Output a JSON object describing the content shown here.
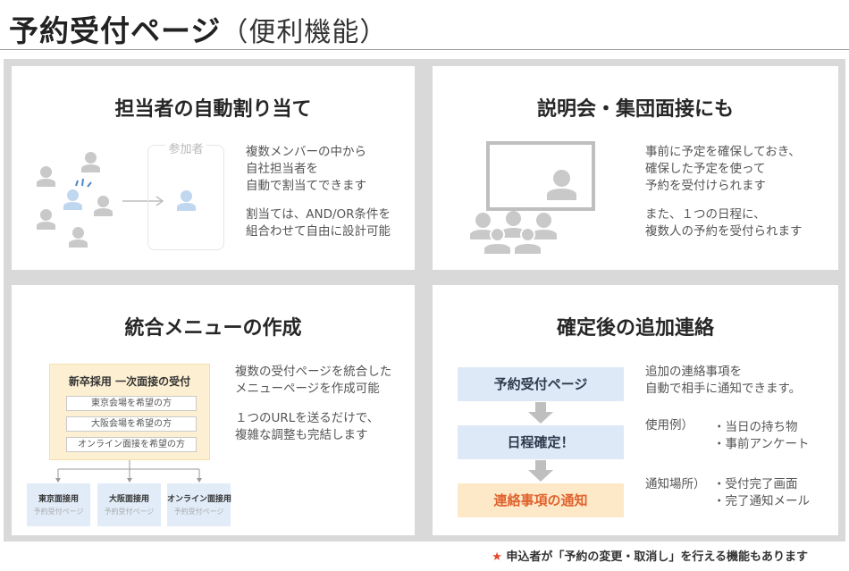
{
  "header": {
    "title": "予約受付ページ",
    "subtitle": "（便利機能）"
  },
  "panels": {
    "assign": {
      "title": "担当者の自動割り当て",
      "box_label": "参加者",
      "text1": "複数メンバーの中から\n自社担当者を\n自動で割当てできます",
      "text2": "割当ては、AND/OR条件を\n組合わせて自由に設計可能"
    },
    "group": {
      "title": "説明会・集団面接にも",
      "text1": "事前に予定を確保しておき、\n確保した予定を使って\n予約を受付けられます",
      "text2": "また、１つの日程に、\n複数人の予約を受付られます"
    },
    "menu": {
      "title": "統合メニューの作成",
      "menu_title": "新卒採用 一次面接の受付",
      "options": [
        "東京会場を希望の方",
        "大阪会場を希望の方",
        "オンライン面接を希望の方"
      ],
      "subpages": [
        {
          "title": "東京面接用",
          "sub": "予約受付ページ"
        },
        {
          "title": "大阪面接用",
          "sub": "予約受付ページ"
        },
        {
          "title": "オンライン面接用",
          "sub": "予約受付ページ"
        }
      ],
      "text1": "複数の受付ページを統合した\nメニューページを作成可能",
      "text2": "１つのURLを送るだけで、\n複雑な調整も完結します"
    },
    "followup": {
      "title": "確定後の追加連絡",
      "flow": [
        "予約受付ページ",
        "日程確定！",
        "連絡事項の通知"
      ],
      "text1": "追加の連絡事項を\n自動で相手に通知できます。",
      "example_label": "使用例）",
      "examples": "・当日の持ち物\n・事前アンケート",
      "place_label": "通知場所）",
      "places": "・受付完了画面\n・完了通知メール"
    }
  },
  "footnote": {
    "star": "★",
    "text": "申込者が「予約の変更・取消し」を行える機能もあります"
  },
  "colors": {
    "person_gray": "#c9c9c9",
    "person_blue": "#bfd7ef",
    "accent_blue": "#4a86c8",
    "flow_blue": "#dde9f6",
    "flow_orange": "#fde9c8",
    "notify_orange": "#e0622d",
    "star_red": "#e8452c"
  }
}
